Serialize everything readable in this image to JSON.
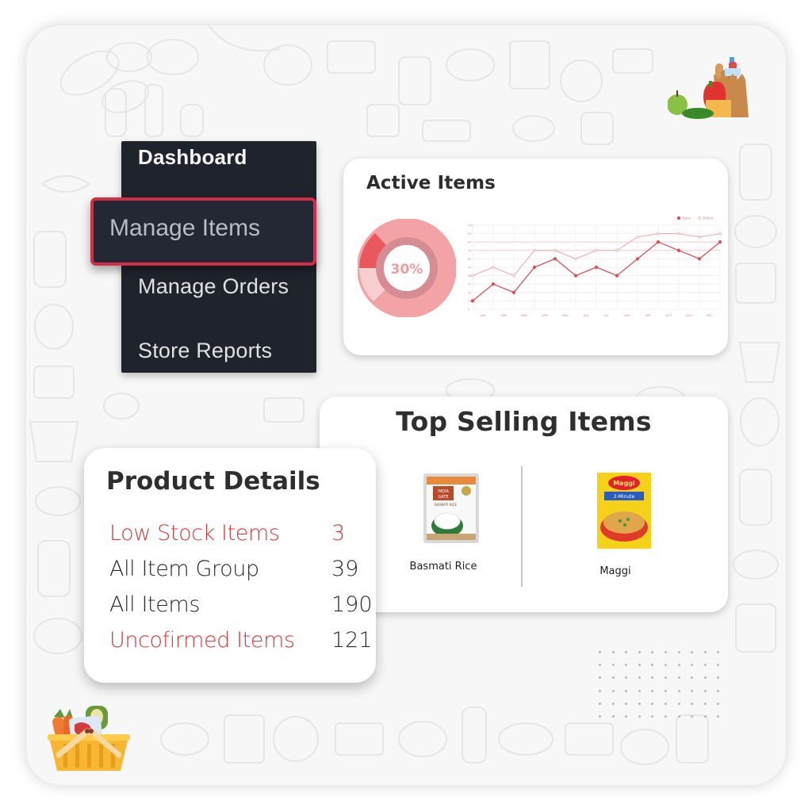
{
  "sidebar": {
    "items": [
      {
        "label": "Dashboard",
        "active": false
      },
      {
        "label": "Manage Items",
        "active": true
      },
      {
        "label": "Manage Orders",
        "active": false
      },
      {
        "label": "Store Reports",
        "active": false
      }
    ],
    "active_border_color": "#d32c47"
  },
  "active_items": {
    "title": "Active Items",
    "donut_label": "30%",
    "donut_value_percent": 30
  },
  "chart_data": {
    "type": "line",
    "title": "",
    "x": [
      "",
      "JAN",
      "FEB",
      "MAR",
      "APR",
      "MAY",
      "JUN",
      "JUL",
      "AUG",
      "SEP",
      "OCT",
      "NOV",
      "DEC"
    ],
    "xtick_labels": [
      "JAN",
      "FEB",
      "MAR",
      "APR",
      "MAY",
      "JUN",
      "JUL",
      "AUG",
      "SEP",
      "OCT",
      "NOV",
      "DEC"
    ],
    "ytick_labels": [
      "0",
      "10",
      "20",
      "30",
      "40",
      "50",
      "60",
      "70",
      "80",
      "90",
      "100"
    ],
    "ylim": [
      0,
      100
    ],
    "grid": true,
    "legend": "top-right",
    "series": [
      {
        "name": "Sales",
        "values": [
          10,
          30,
          20,
          50,
          60,
          40,
          50,
          40,
          60,
          80,
          70,
          60,
          80
        ],
        "color": "#d9505c",
        "marker": "filled"
      },
      {
        "name": "Orders",
        "values": [
          40,
          50,
          40,
          70,
          70,
          60,
          70,
          70,
          86,
          90,
          90,
          86,
          90
        ],
        "color": "#eaa7ad",
        "marker": "hollow"
      }
    ]
  },
  "top_selling": {
    "title": "Top Selling Items",
    "items": [
      {
        "name": "Basmati Rice",
        "brand_text": "INDIA GATE",
        "sub_text": "BASMATI RICE"
      },
      {
        "name": "Maggi",
        "brand_text": "Maggi",
        "sub_text": "2-Minute noodles"
      }
    ]
  },
  "product_details": {
    "title": "Product Details",
    "rows": [
      {
        "label": "Low Stock Items",
        "value": "3",
        "highlight": true
      },
      {
        "label": "All Item Group",
        "value": "39",
        "highlight": false
      },
      {
        "label": "All Items",
        "value": "190",
        "highlight": false
      },
      {
        "label": "Uncofirmed Items",
        "value": "121",
        "highlight": true
      }
    ],
    "highlight_color": "#d63a3a"
  },
  "decorations": {
    "top_right": "grocery-bag-icon",
    "bottom_left": "grocery-basket-icon"
  }
}
